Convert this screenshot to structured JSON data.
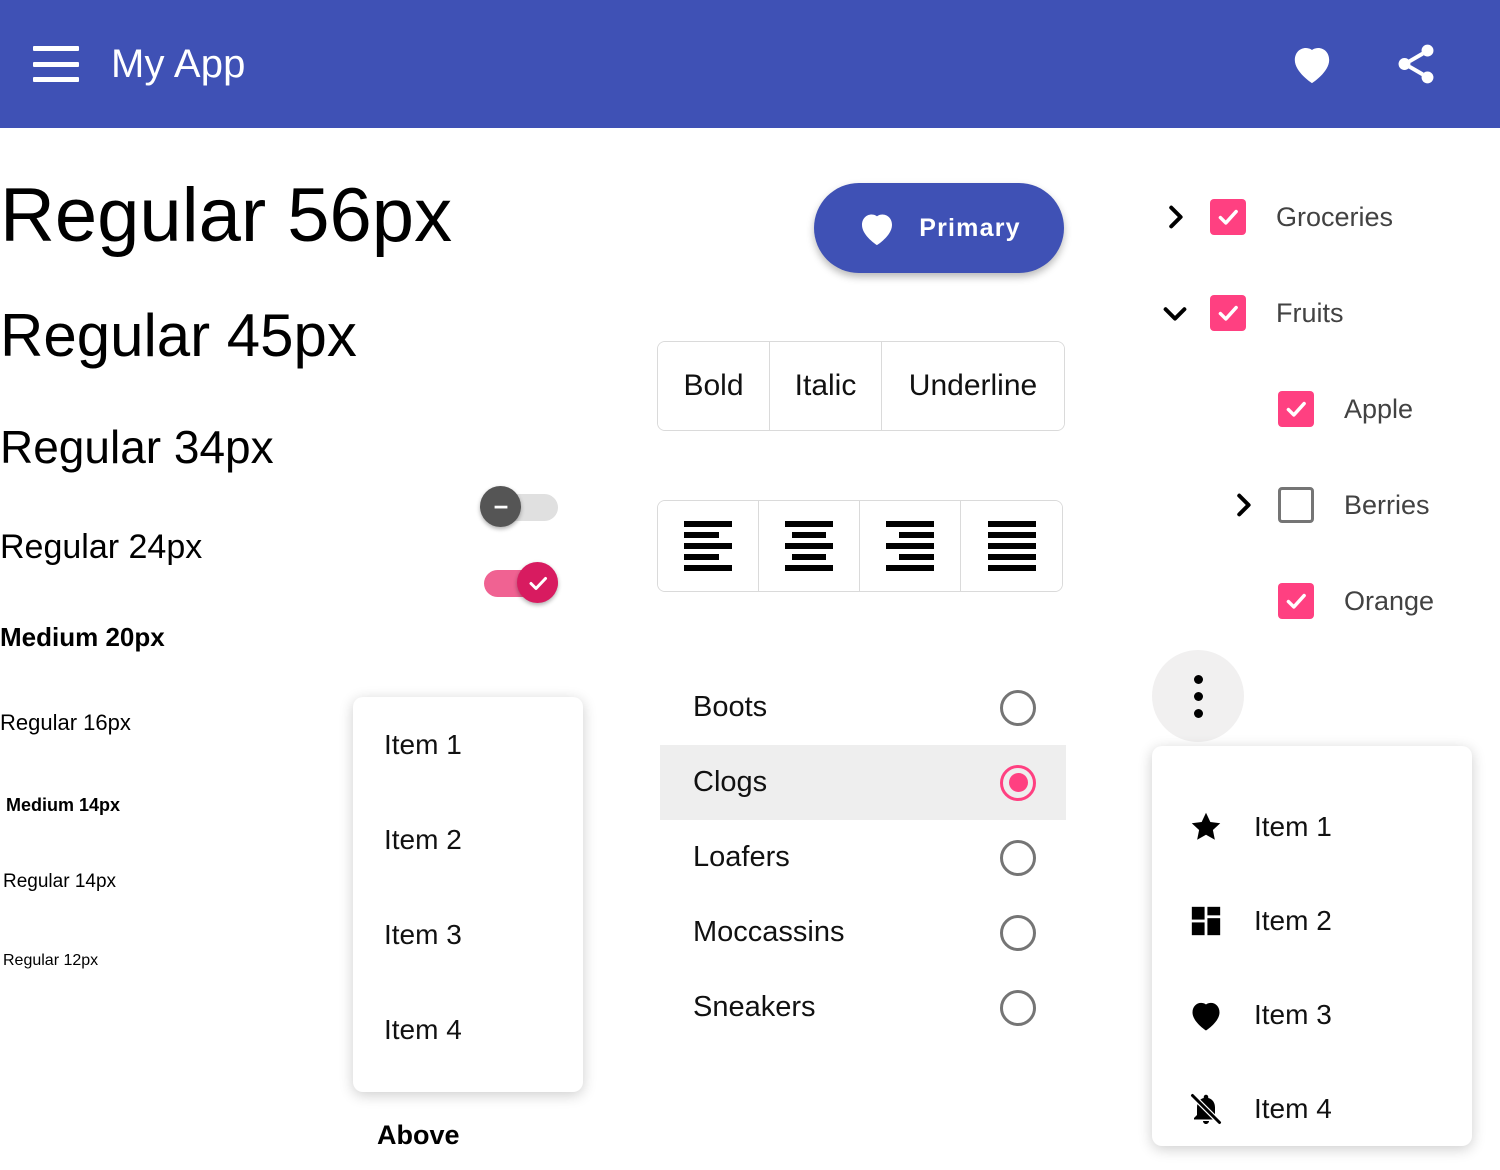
{
  "appbar": {
    "menu_icon": "hamburger-menu-icon",
    "title": "My App",
    "favorite_icon": "heart-icon",
    "share_icon": "share-icon",
    "background_color": "#3F51B5"
  },
  "typography": {
    "samples": [
      {
        "label": "Regular 56px"
      },
      {
        "label": "Regular 45px"
      },
      {
        "label": "Regular 34px"
      },
      {
        "label": "Regular 24px"
      },
      {
        "label": "Medium 20px"
      },
      {
        "label": "Regular 16px"
      },
      {
        "label": "Medium 14px"
      },
      {
        "label": "Regular 14px"
      },
      {
        "label": "Regular 12px"
      }
    ]
  },
  "switches": [
    {
      "name": "switch-off",
      "state": "off",
      "icon": "minus-icon",
      "track_color": "#E0E0E0",
      "thumb_color": "#555555"
    },
    {
      "name": "switch-on",
      "state": "on",
      "icon": "check-icon",
      "track_color": "#F06292",
      "thumb_color": "#D81B60"
    }
  ],
  "primary_button": {
    "label": "Primary",
    "icon": "heart-icon",
    "color": "#3F51B5"
  },
  "text_style_group": {
    "options": [
      {
        "label": "Bold",
        "selected": false
      },
      {
        "label": "Italic",
        "selected": false
      },
      {
        "label": "Underline",
        "selected": false
      }
    ]
  },
  "align_group": {
    "options": [
      {
        "icon": "align-left-icon",
        "selected": false
      },
      {
        "icon": "align-center-icon",
        "selected": false
      },
      {
        "icon": "align-right-icon",
        "selected": false
      },
      {
        "icon": "align-justify-icon",
        "selected": false
      }
    ]
  },
  "radio_list": {
    "items": [
      {
        "label": "Boots",
        "selected": false
      },
      {
        "label": "Clogs",
        "selected": true
      },
      {
        "label": "Loafers",
        "selected": false
      },
      {
        "label": "Moccassins",
        "selected": false
      },
      {
        "label": "Sneakers",
        "selected": false
      }
    ],
    "selected_color": "#FF4081",
    "selected_row_background": "#EEEEEE"
  },
  "plain_menu": {
    "items": [
      {
        "label": "Item 1"
      },
      {
        "label": "Item 2"
      },
      {
        "label": "Item 3"
      },
      {
        "label": "Item 4"
      }
    ],
    "caption": "Above"
  },
  "tree": {
    "checkbox_color": "#FF4081",
    "nodes": [
      {
        "label": "Groceries",
        "checked": true,
        "expander": "chevron-right-icon",
        "level": 0
      },
      {
        "label": "Fruits",
        "checked": true,
        "expander": "chevron-down-icon",
        "level": 0
      },
      {
        "label": "Apple",
        "checked": true,
        "expander": "none",
        "level": 1
      },
      {
        "label": "Berries",
        "checked": false,
        "expander": "chevron-right-icon",
        "level": 1
      },
      {
        "label": "Orange",
        "checked": true,
        "expander": "none",
        "level": 1
      }
    ]
  },
  "overflow": {
    "button_icon": "more-vert-icon",
    "items": [
      {
        "label": "Item 1",
        "icon": "star-icon"
      },
      {
        "label": "Item 2",
        "icon": "dashboard-icon"
      },
      {
        "label": "Item 3",
        "icon": "heart-icon"
      },
      {
        "label": "Item 4",
        "icon": "notifications-off-icon"
      }
    ]
  }
}
